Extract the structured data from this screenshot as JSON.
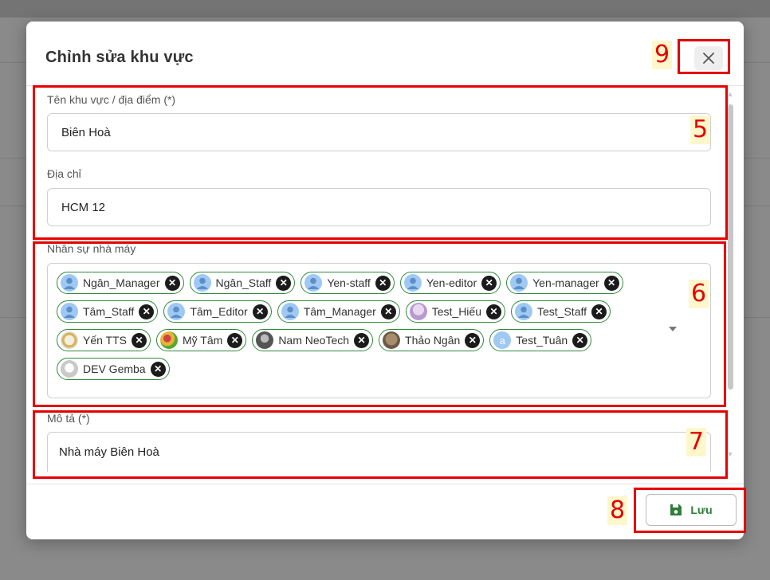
{
  "modal": {
    "title": "Chỉnh sửa khu vực",
    "close_icon": "close-icon"
  },
  "form": {
    "name_label": "Tên khu vực / địa điểm (*)",
    "name_value": "Biên Hoà",
    "address_label": "Địa chỉ",
    "address_value": "HCM 12",
    "staff_label": "Nhân sự nhà máy",
    "description_label": "Mô tả (*)",
    "description_value": "Nhà máy Biên Hoà"
  },
  "staff_chips": [
    {
      "label": "Ngân_Manager",
      "avatar": "person-icon"
    },
    {
      "label": "Ngân_Staff",
      "avatar": "person-icon"
    },
    {
      "label": "Yen-staff",
      "avatar": "person-icon"
    },
    {
      "label": "Yen-editor",
      "avatar": "person-icon"
    },
    {
      "label": "Yen-manager",
      "avatar": "person-icon"
    },
    {
      "label": "Tâm_Staff",
      "avatar": "person-icon"
    },
    {
      "label": "Tâm_Editor",
      "avatar": "person-icon"
    },
    {
      "label": "Tâm_Manager",
      "avatar": "person-icon"
    },
    {
      "label": "Test_Hiếu",
      "avatar": "photo"
    },
    {
      "label": "Test_Staff",
      "avatar": "person-icon"
    },
    {
      "label": "Yến TTS",
      "avatar": "photo"
    },
    {
      "label": "Mỹ Tâm",
      "avatar": "photo"
    },
    {
      "label": "Nam NeoTech",
      "avatar": "photo"
    },
    {
      "label": "Thảo Ngân",
      "avatar": "photo"
    },
    {
      "label": "Test_Tuân",
      "avatar": "letter",
      "letter": "a"
    },
    {
      "label": "DEV Gemba",
      "avatar": "photo"
    }
  ],
  "footer": {
    "save_label": "Lưu",
    "save_icon": "save-icon"
  },
  "annotations": [
    {
      "number": "5"
    },
    {
      "number": "6"
    },
    {
      "number": "7"
    },
    {
      "number": "8"
    },
    {
      "number": "9"
    }
  ],
  "colors": {
    "chip_border": "#2e8b3a",
    "save_text": "#2e7d3a",
    "annotation": "#e60000",
    "annotation_bg": "#fff7cc"
  }
}
